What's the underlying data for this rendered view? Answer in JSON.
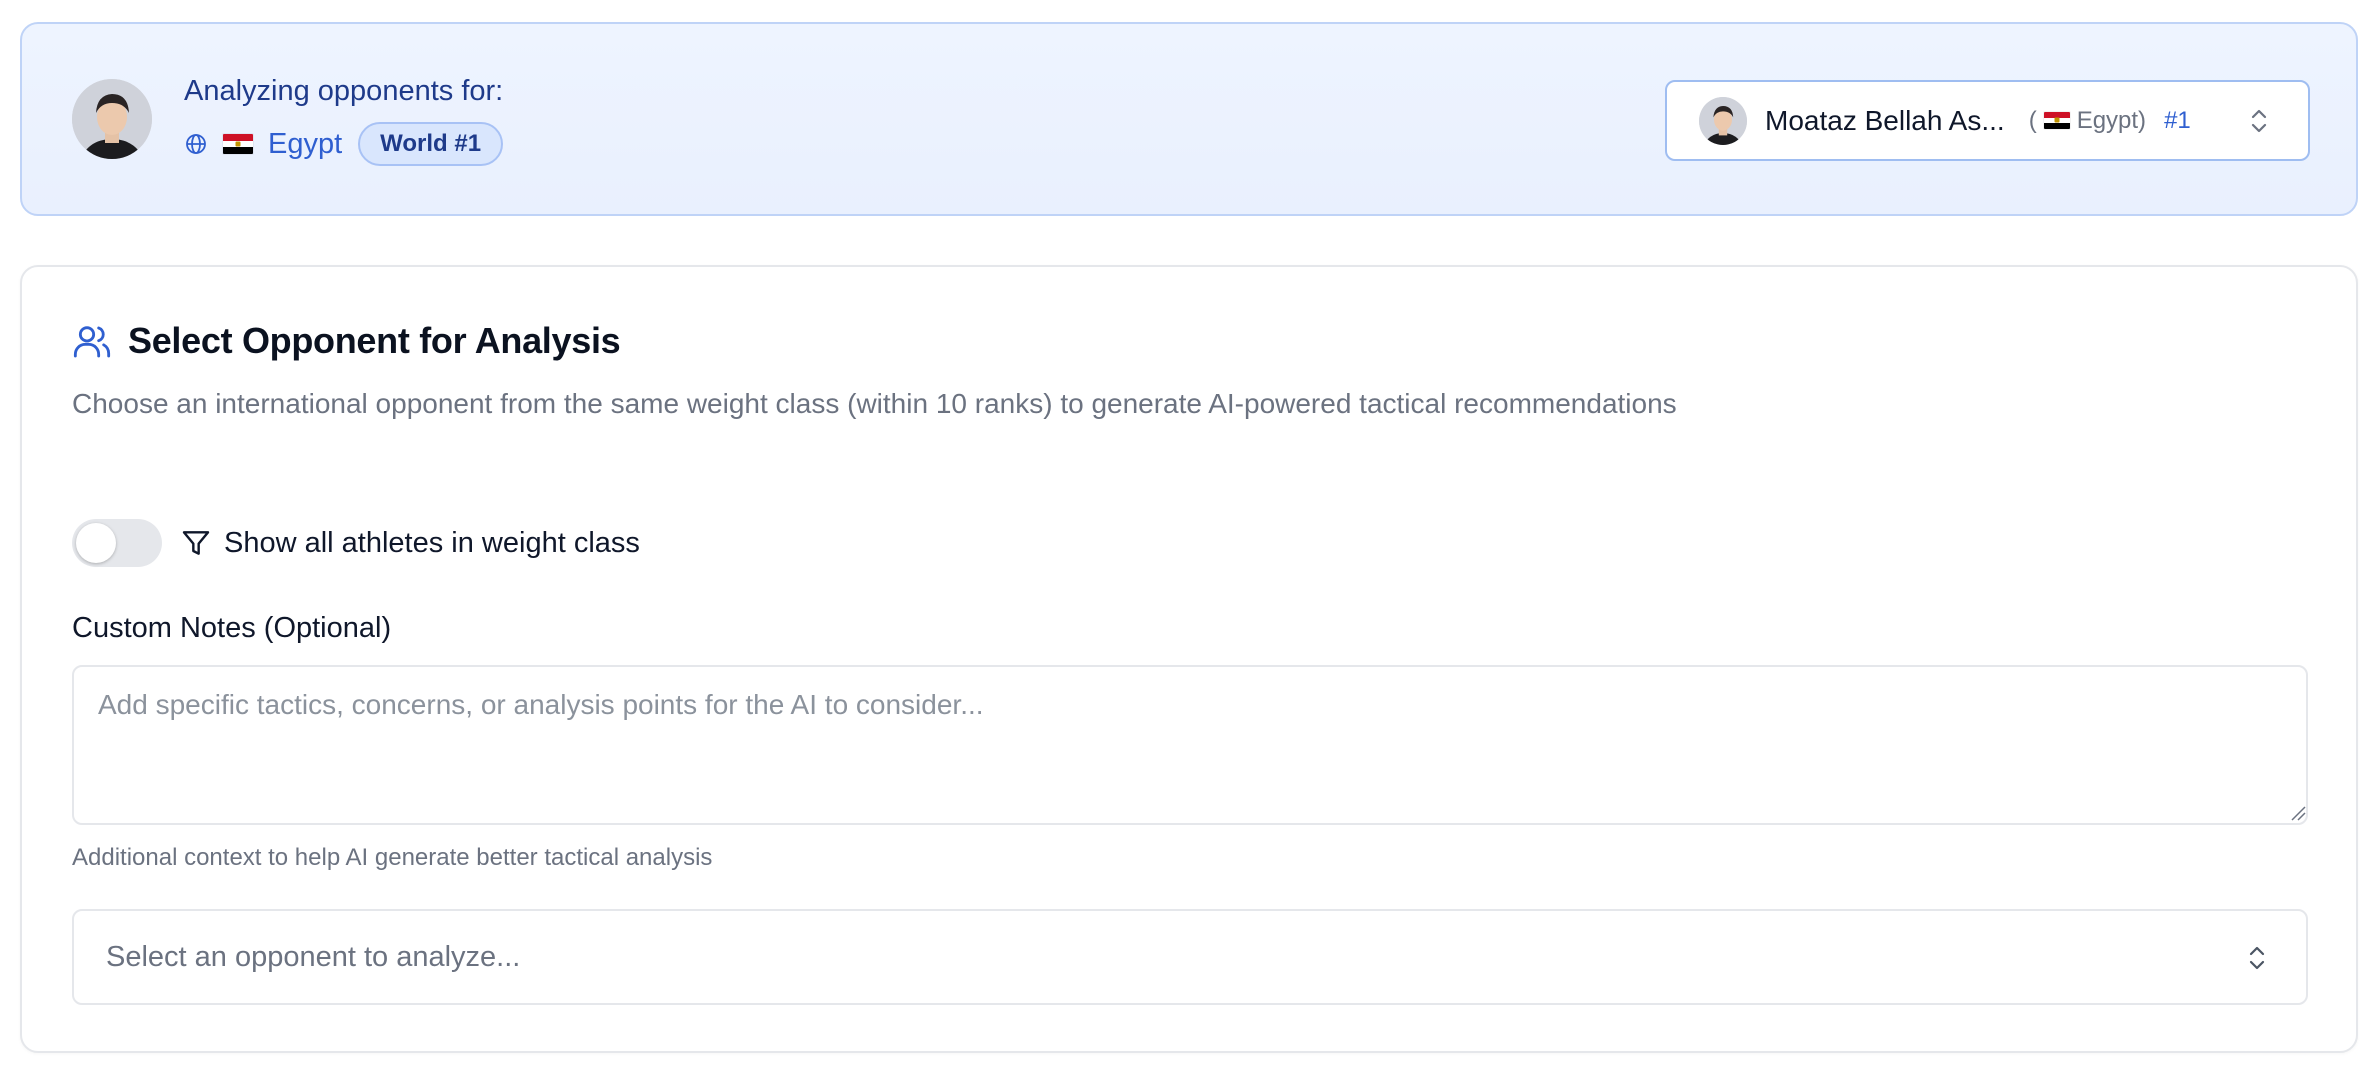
{
  "header": {
    "analyzing_label": "Analyzing opponents for:",
    "country": "Egypt",
    "rank_badge": "World #1",
    "selected_athlete": {
      "name": "Moataz Bellah As...",
      "country_open": "(",
      "country": "Egypt)",
      "rank": "#1"
    }
  },
  "main": {
    "title": "Select Opponent for Analysis",
    "description": "Choose an international opponent from the same weight class (within 10 ranks) to generate AI-powered tactical recommendations",
    "toggle": {
      "label": "Show all athletes in weight class",
      "checked": false
    },
    "notes": {
      "label": "Custom Notes (Optional)",
      "value": "",
      "placeholder": "Add specific tactics, concerns, or analysis points for the AI to consider...",
      "hint": "Additional context to help AI generate better tactical analysis"
    },
    "opponent_select": {
      "placeholder": "Select an opponent to analyze..."
    }
  },
  "icons": {
    "globe": "globe-icon",
    "users": "users-icon",
    "filter": "filter-icon",
    "chevrons": "chevron-up-down-icon",
    "flag": "egypt-flag-icon"
  },
  "colors": {
    "accent_blue": "#2f5fd0",
    "header_bg": "#eef4ff",
    "header_border": "#bfd3f7",
    "dark_blue_text": "#1e3a8a"
  }
}
